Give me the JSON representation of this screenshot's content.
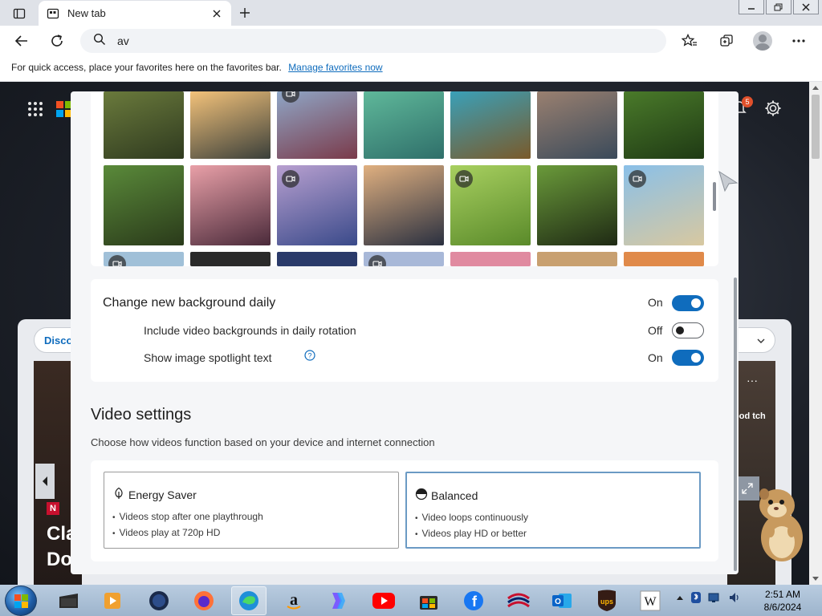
{
  "browser": {
    "tab_title": "New tab",
    "address_text": "av"
  },
  "favorites_bar": {
    "message": "For quick access, place your favorites here on the favorites bar.",
    "link": "Manage favorites now"
  },
  "ntp": {
    "notification_count": "5",
    "feed_pill": "Disco",
    "news_title": "Cla Do",
    "news_source_letter": "N",
    "side_text": "ood tch"
  },
  "settings": {
    "background_daily": {
      "label": "Change new background daily",
      "state": "On",
      "on": true
    },
    "video_rotation": {
      "label": "Include video backgrounds in daily rotation",
      "state": "Off",
      "on": false
    },
    "spotlight": {
      "label": "Show image spotlight text",
      "state": "On",
      "on": true
    },
    "video_settings": {
      "title": "Video settings",
      "description": "Choose how videos function based on your device and internet connection",
      "options": [
        {
          "name": "Energy Saver",
          "icon": "leaf-icon",
          "lines": [
            "Videos stop after one playthrough",
            "Videos play at 720p HD"
          ],
          "selected": false
        },
        {
          "name": "Balanced",
          "icon": "half-circle-icon",
          "lines": [
            "Video loops continuously",
            "Videos play HD or better"
          ],
          "selected": true
        }
      ]
    }
  },
  "gallery": {
    "rows": [
      [
        {
          "video": false,
          "c1": "#6a7a3c",
          "c2": "#2f3a1f"
        },
        {
          "video": false,
          "c1": "#f3c27a",
          "c2": "#3a3f3a"
        },
        {
          "video": true,
          "c1": "#8fa6c6",
          "c2": "#7a3a4a"
        },
        {
          "video": false,
          "c1": "#5fb89a",
          "c2": "#2f6f6a"
        },
        {
          "video": false,
          "c1": "#3aa0b8",
          "c2": "#7a5a2a"
        },
        {
          "video": false,
          "c1": "#9a8070",
          "c2": "#3a4a5a"
        },
        {
          "video": false,
          "c1": "#4a7a2a",
          "c2": "#1f3a14"
        }
      ],
      [
        {
          "video": false,
          "c1": "#5a8a3a",
          "c2": "#2a3a1a"
        },
        {
          "video": false,
          "c1": "#e9a0a8",
          "c2": "#4a2a3a"
        },
        {
          "video": true,
          "c1": "#b8a0d0",
          "c2": "#3a4a8a"
        },
        {
          "video": false,
          "c1": "#e0b080",
          "c2": "#2a3040"
        },
        {
          "video": true,
          "c1": "#a8d060",
          "c2": "#5a8a2a"
        },
        {
          "video": false,
          "c1": "#6a9a3a",
          "c2": "#1f2a14"
        },
        {
          "video": true,
          "c1": "#8ac0e8",
          "c2": "#d8c8a0"
        }
      ],
      [
        {
          "video": true,
          "c1": "#a0c0d8",
          "c2": "#a0c0d8"
        },
        {
          "video": false,
          "c1": "#2a2a2a",
          "c2": "#2a2a2a"
        },
        {
          "video": false,
          "c1": "#2a3a6a",
          "c2": "#2a3a6a"
        },
        {
          "video": true,
          "c1": "#a8b8d8",
          "c2": "#a8b8d8"
        },
        {
          "video": false,
          "c1": "#e08aa0",
          "c2": "#e08aa0"
        },
        {
          "video": false,
          "c1": "#c8a070",
          "c2": "#c8a070"
        },
        {
          "video": false,
          "c1": "#e08a4a",
          "c2": "#e08a4a"
        }
      ]
    ]
  },
  "taskbar": {
    "apps": [
      "explorer-icon",
      "media-icon",
      "globe-icon",
      "firefox-icon",
      "edge-icon",
      "amazon-icon",
      "copilot-icon",
      "youtube-icon",
      "store-icon",
      "facebook-icon",
      "bank-icon",
      "outlook-icon",
      "ups-icon",
      "wikipedia-icon"
    ],
    "active_app": "edge-icon",
    "time": "2:51 AM",
    "date": "8/6/2024"
  },
  "colors": {
    "accent": "#0f6cbd",
    "toggle_on": "#0f6cbd",
    "selected_border": "#6b9ac4"
  }
}
